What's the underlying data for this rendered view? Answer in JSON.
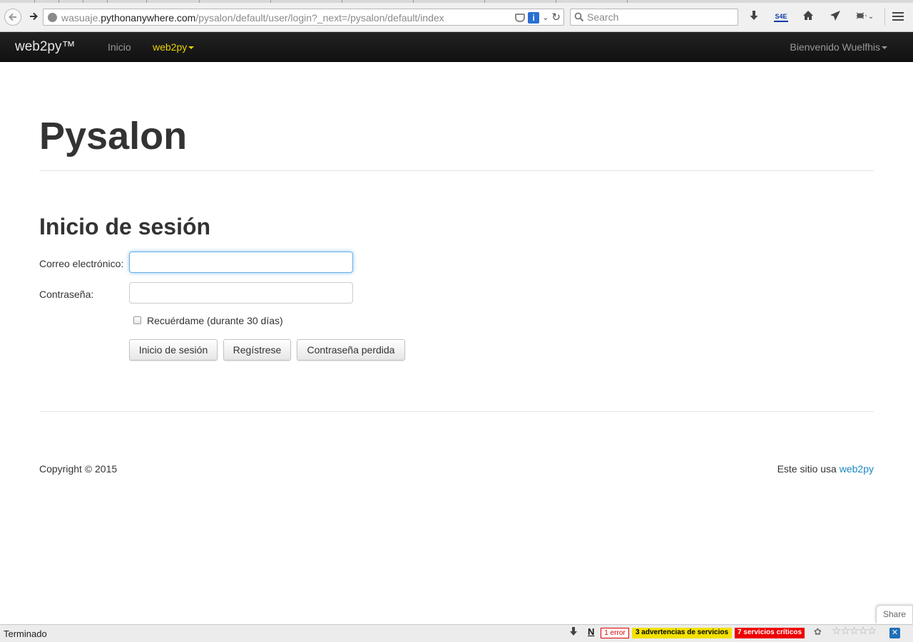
{
  "browser": {
    "url_host_prefix": "wasuaje.",
    "url_host_domain": "pythonanywhere.com",
    "url_path": "/pysalon/default/user/login?_next=/pysalon/default/index",
    "search_placeholder": "Search",
    "toolbar_icons": [
      "download-arrow-icon",
      "s4e-icon",
      "home-icon",
      "send-icon",
      "bug-icon",
      "hamburger-menu-icon"
    ],
    "s4e_label": "S4E"
  },
  "navbar": {
    "brand": "web2py™",
    "items": [
      {
        "label": "Inicio"
      },
      {
        "label": "web2py"
      }
    ],
    "user_menu": "Bienvenido Wuelfhis"
  },
  "page": {
    "title": "Pysalon",
    "form": {
      "heading": "Inicio de sesión",
      "email_label": "Correo electrónico:",
      "email_value": "",
      "password_label": "Contraseña:",
      "password_value": "",
      "remember_label": "Recuérdame (durante 30 días)",
      "remember_checked": false,
      "buttons": {
        "login": "Inicio de sesión",
        "register": "Regístrese",
        "lost_password": "Contraseña perdida"
      }
    },
    "footer": {
      "copyright": "Copyright © 2015",
      "powered_prefix": "Este sitio usa ",
      "powered_link": "web2py"
    }
  },
  "share": "Share",
  "statusbar": {
    "text": "Terminado",
    "errors": "1 error",
    "warnings": "3 advertencias de servicios",
    "critical": "7 servicios críticos",
    "n_badge": "N"
  },
  "colors": {
    "navbar_bg": "#1b1b1b",
    "active_nav": "#e9d100",
    "link": "#1a86c4",
    "focus": "#66afe9"
  }
}
